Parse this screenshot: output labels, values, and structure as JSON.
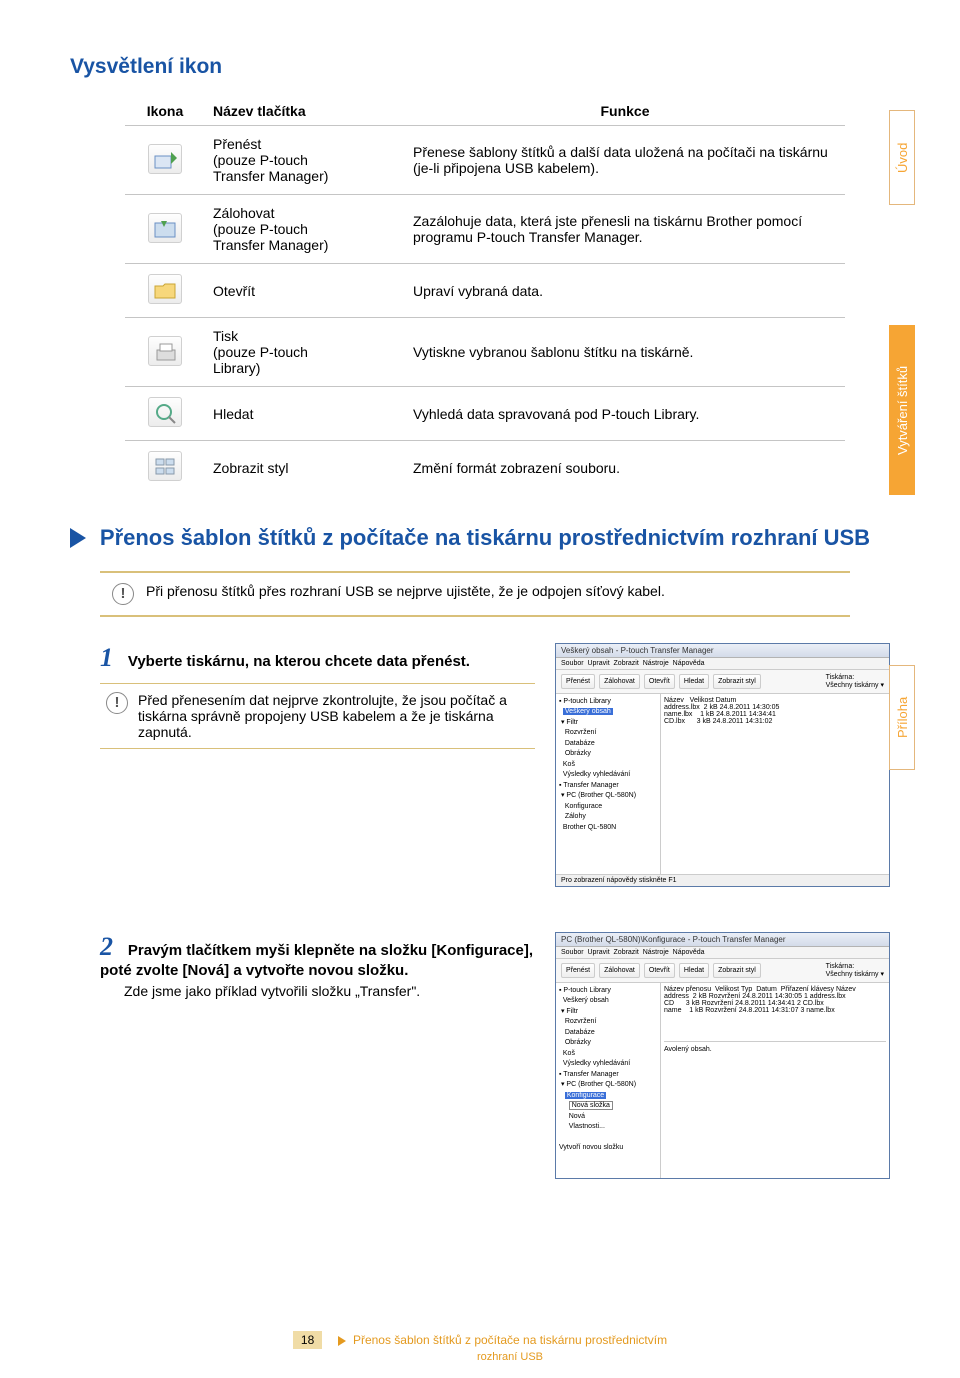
{
  "heading": "Vysvětlení ikon",
  "table": {
    "headers": {
      "icon": "Ikona",
      "name": "Název tlačítka",
      "func": "Funkce"
    },
    "rows": [
      {
        "name": "Přenést\n(pouze P-touch\nTransfer Manager)",
        "func": "Přenese šablony štítků a další data uložená na počítači na tiskárnu (je-li připojena USB kabelem)."
      },
      {
        "name": "Zálohovat\n(pouze P-touch\nTransfer Manager)",
        "func": "Zazálohuje data, která jste přenesli na tiskárnu Brother pomocí programu P-touch Transfer Manager."
      },
      {
        "name": "Otevřít",
        "func": "Upraví vybraná data."
      },
      {
        "name": "Tisk\n(pouze P-touch\nLibrary)",
        "func": "Vytiskne vybranou šablonu štítku na tiskárně."
      },
      {
        "name": "Hledat",
        "func": "Vyhledá data spravovaná pod P-touch Library."
      },
      {
        "name": "Zobrazit styl",
        "func": "Změní formát zobrazení souboru."
      }
    ]
  },
  "tabs": {
    "uvod": "Úvod",
    "stitky": "Vytváření štítků",
    "priloha": "Příloha"
  },
  "section_title": "Přenos šablon štítků z počítače na tiskárnu prostřednictvím rozhraní USB",
  "alert_main": "Při přenosu štítků přes rozhraní USB se nejprve ujistěte, že je odpojen síťový kabel.",
  "steps": [
    {
      "num": "1",
      "title": "Vyberte tiskárnu, na kterou chcete data přenést.",
      "note": "Před přenesením dat nejprve zkontrolujte, že jsou počítač a tiskárna správně propojeny USB kabelem a že je tiskárna zapnutá."
    },
    {
      "num": "2",
      "title": "Pravým tlačítkem myši klepněte na složku [Konfigurace], poté zvolte [Nová] a vytvořte novou složku.",
      "body": "Zde jsme jako příklad vytvořili složku „Transfer\"."
    }
  ],
  "footer": {
    "page": "18",
    "crumb1": "Přenos šablon štítků z počítače na tiskárnu prostřednictvím",
    "crumb2": "rozhraní USB"
  },
  "shot1": {
    "title": "Veškerý obsah - P-touch Transfer Manager",
    "toolbar": [
      "Přenést",
      "Zálohovat",
      "Otevřít",
      "Hledat",
      "Zobrazit styl"
    ],
    "status": "Pro zobrazení nápovědy stiskněte F1"
  }
}
